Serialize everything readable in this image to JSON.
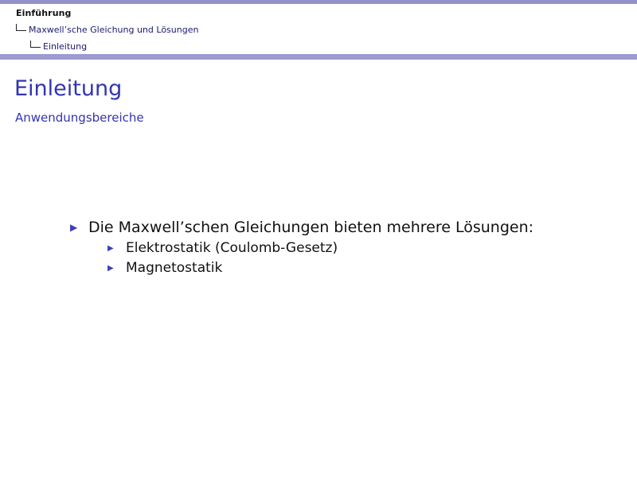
{
  "header": {
    "section": "Einführung",
    "subsection": "Maxwell’sche Gleichung und Lösungen",
    "subsubsection": "Einleitung"
  },
  "frame": {
    "title": "Einleitung",
    "subtitle": "Anwendungsbereiche"
  },
  "content": {
    "items": [
      {
        "text": "Die Maxwell’schen Gleichungen bieten mehrere Lösungen:",
        "subitems": [
          "Elektrostatik (Coulomb-Gesetz)",
          "Magnetostatik"
        ]
      }
    ]
  },
  "colors": {
    "accent": "#3434b2",
    "header_band": "#9b9bd0",
    "bullet": "#4040b8"
  },
  "icons": {
    "bullet": "triangle-right-icon"
  }
}
